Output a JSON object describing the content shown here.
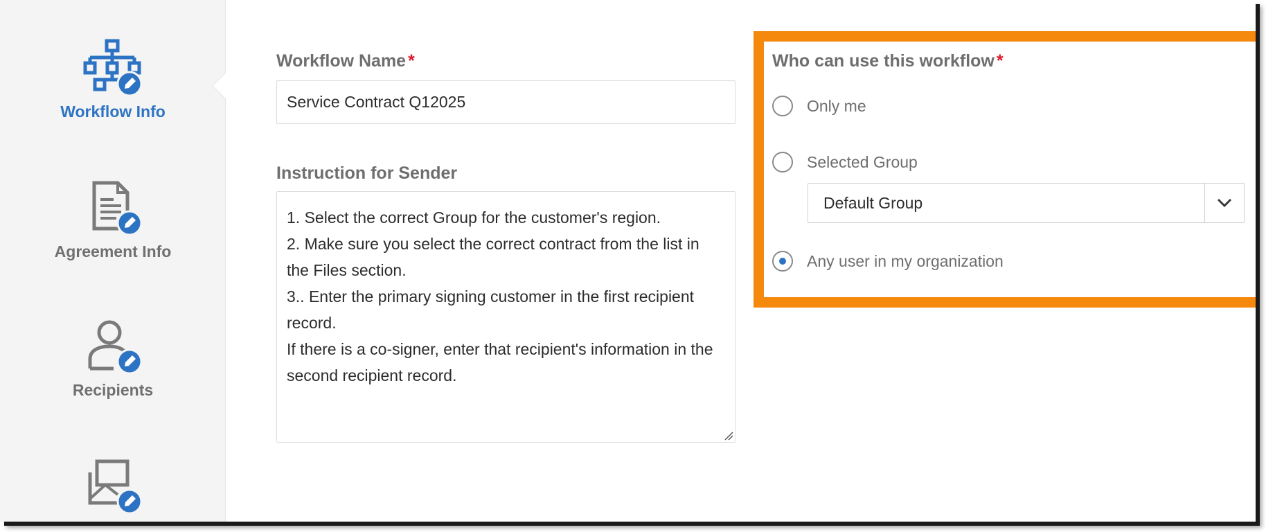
{
  "sidebar": {
    "items": [
      {
        "label": "Workflow Info",
        "icon": "workflow-diagram-icon",
        "active": true
      },
      {
        "label": "Agreement Info",
        "icon": "document-edit-icon",
        "active": false
      },
      {
        "label": "Recipients",
        "icon": "user-edit-icon",
        "active": false
      },
      {
        "label": "",
        "icon": "envelope-edit-icon",
        "active": false
      }
    ]
  },
  "form": {
    "workflow_name": {
      "label": "Workflow Name",
      "required_mark": "*",
      "value": "Service Contract Q12025"
    },
    "instruction": {
      "label": "Instruction for Sender",
      "lines": [
        "1. Select the correct Group for the customer's region.",
        "2.  Make sure you select the correct contract from the list in",
        "the Files section.",
        "3.. Enter the primary signing customer in the first recipient",
        "record.",
        "If there is a co-signer, enter that recipient's information in the",
        "second recipient record."
      ]
    }
  },
  "who_can_use": {
    "label": "Who can use this workflow",
    "required_mark": "*",
    "options": [
      {
        "label": "Only me",
        "checked": false
      },
      {
        "label": "Selected Group",
        "checked": false
      },
      {
        "label": "Any user in my organization",
        "checked": true
      }
    ],
    "group_select": {
      "value": "Default Group"
    }
  },
  "colors": {
    "accent": "#2d73c4",
    "highlight_border": "#f5890d",
    "required": "#e0182a"
  }
}
